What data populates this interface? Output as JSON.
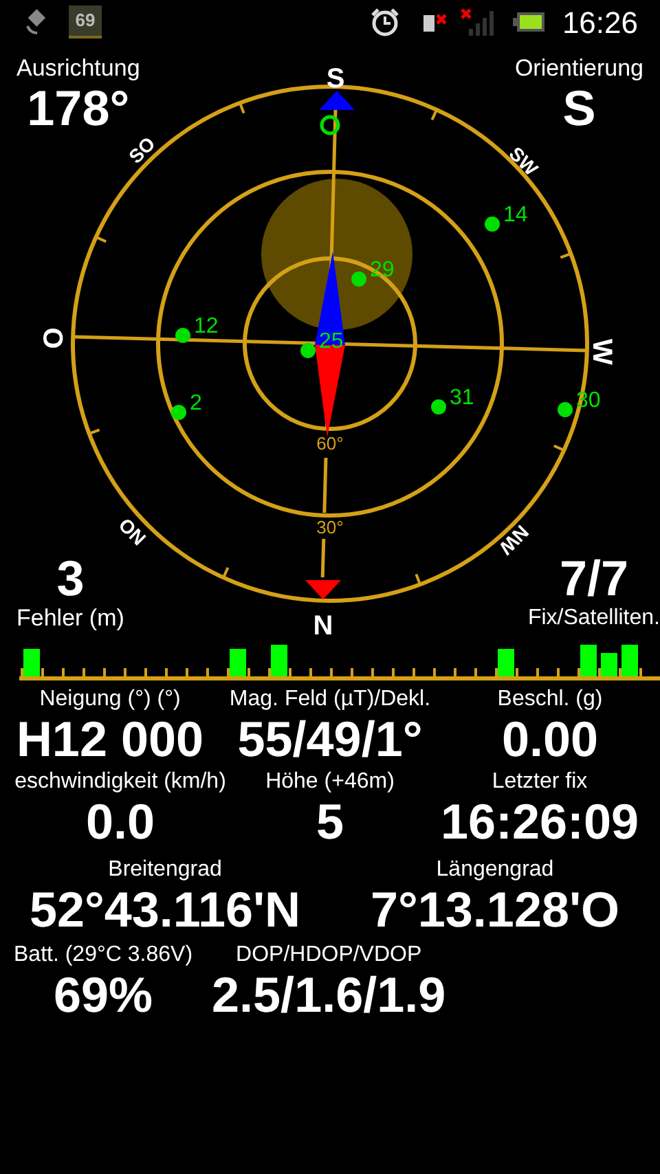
{
  "status_bar": {
    "badge": "69",
    "time": "16:26"
  },
  "heading": {
    "label": "Ausrichtung",
    "value": "178°"
  },
  "orientation": {
    "label": "Orientierung",
    "value": "S"
  },
  "compass": {
    "directions": [
      "S",
      "SW",
      "W",
      "NW",
      "N",
      "NO",
      "O",
      "SO"
    ],
    "ring_labels": [
      "60°",
      "30°"
    ],
    "satellites": [
      {
        "label": "14"
      },
      {
        "label": "29"
      },
      {
        "label": "12"
      },
      {
        "label": "25"
      },
      {
        "label": "2"
      },
      {
        "label": "31"
      },
      {
        "label": "30"
      }
    ]
  },
  "error": {
    "value": "3",
    "label": "Fehler (m)"
  },
  "fix": {
    "value": "7/7",
    "label": "Fix/Satelliten."
  },
  "readings": [
    [
      {
        "label": "Neigung (°) (°)",
        "value": "H12 000"
      },
      {
        "label": "Mag. Feld (µT)/Dekl.",
        "value": "55/49/1°"
      },
      {
        "label": "Beschl. (g)",
        "value": "0.00"
      }
    ],
    [
      {
        "label": "eschwindigkeit (km/h)",
        "value": "0.0"
      },
      {
        "label": "Höhe (+46m)",
        "value": "5"
      },
      {
        "label": "Letzter fix",
        "value": "16:26:09"
      }
    ],
    [
      {
        "label": "Breitengrad",
        "value": "52°43.116'N"
      },
      {
        "label": "Längengrad",
        "value": "7°13.128'O"
      }
    ],
    [
      {
        "label": "Batt. (29°C 3.86V)",
        "value": "69%"
      },
      {
        "label": "DOP/HDOP/VDOP",
        "value": "2.5/1.6/1.9"
      }
    ]
  ]
}
